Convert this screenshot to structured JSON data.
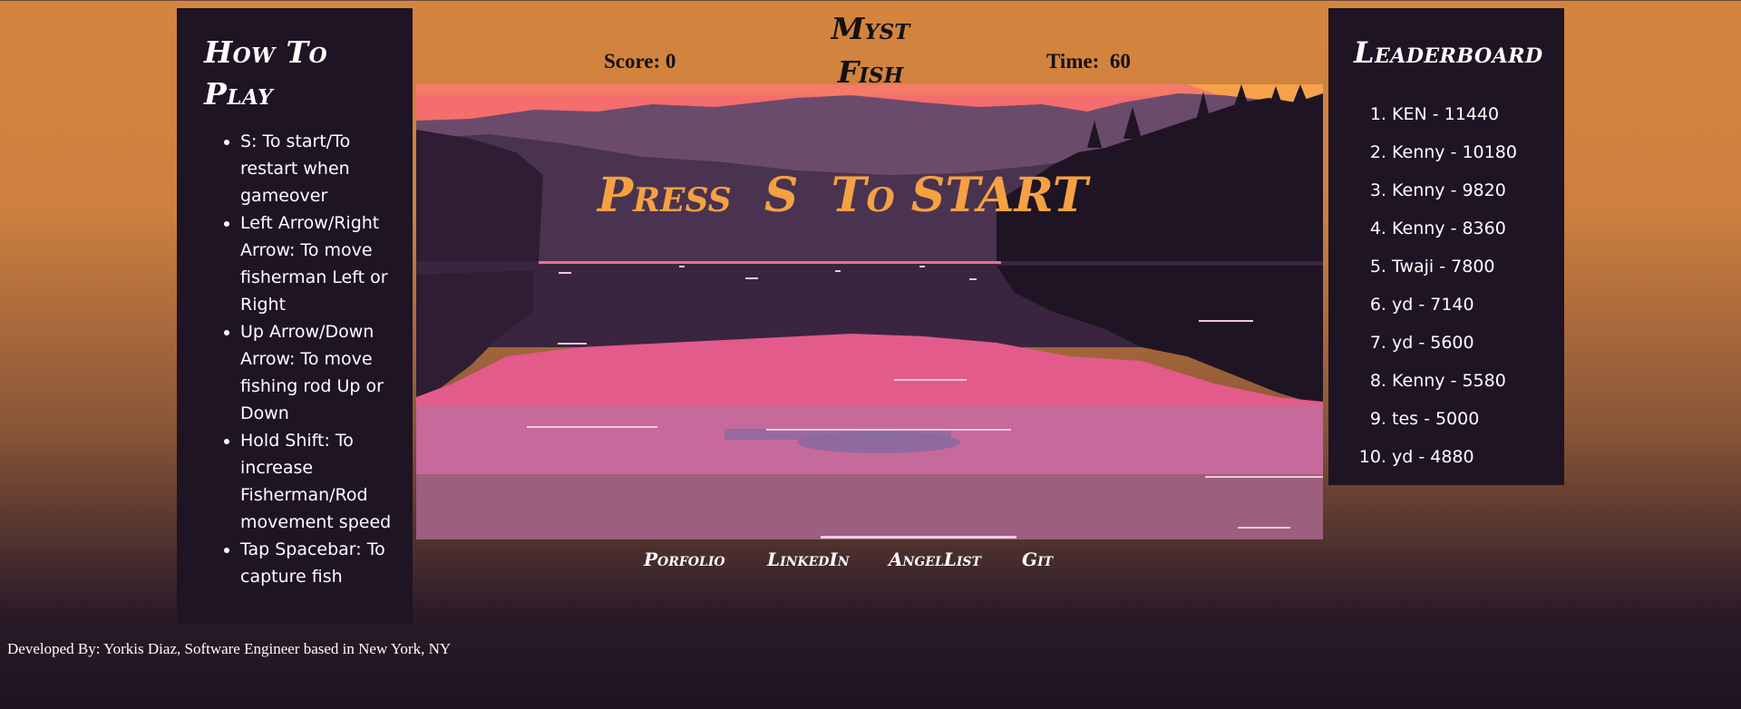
{
  "title": "Myst Fish",
  "hud": {
    "score_label": "Score:",
    "score_value": "0",
    "time_label": "Time:",
    "time_value": "60"
  },
  "how_to_play": {
    "title_line1": "How To",
    "title_line2": "Play",
    "items": [
      "S: To start/To restart when gameover",
      "Left Arrow/Right Arrow: To move fisherman Left or Right",
      "Up Arrow/Down Arrow: To move fishing rod Up or Down",
      "Hold Shift: To increase Fisherman/Rod movement speed",
      "Tap Spacebar: To capture fish"
    ]
  },
  "leaderboard": {
    "title": "Leaderboard",
    "entries": [
      "KEN - 11440",
      "Kenny - 10180",
      "Kenny - 9820",
      "Kenny - 8360",
      "Twaji - 7800",
      "yd - 7140",
      "yd - 5600",
      "Kenny - 5580",
      "tes - 5000",
      "yd - 4880"
    ]
  },
  "game": {
    "overlay_text": "Press  S  To START",
    "overlay_color": "#f5a142",
    "sky_color": "#f56d6d",
    "lake_color": "#3a2540",
    "reflection_color": "#e35b8a"
  },
  "links": [
    "Porfolio",
    "LinkedIn",
    "AngelList",
    "Git"
  ],
  "footer": "Developed By: Yorkis Diaz, Software Engineer based in New York, NY"
}
